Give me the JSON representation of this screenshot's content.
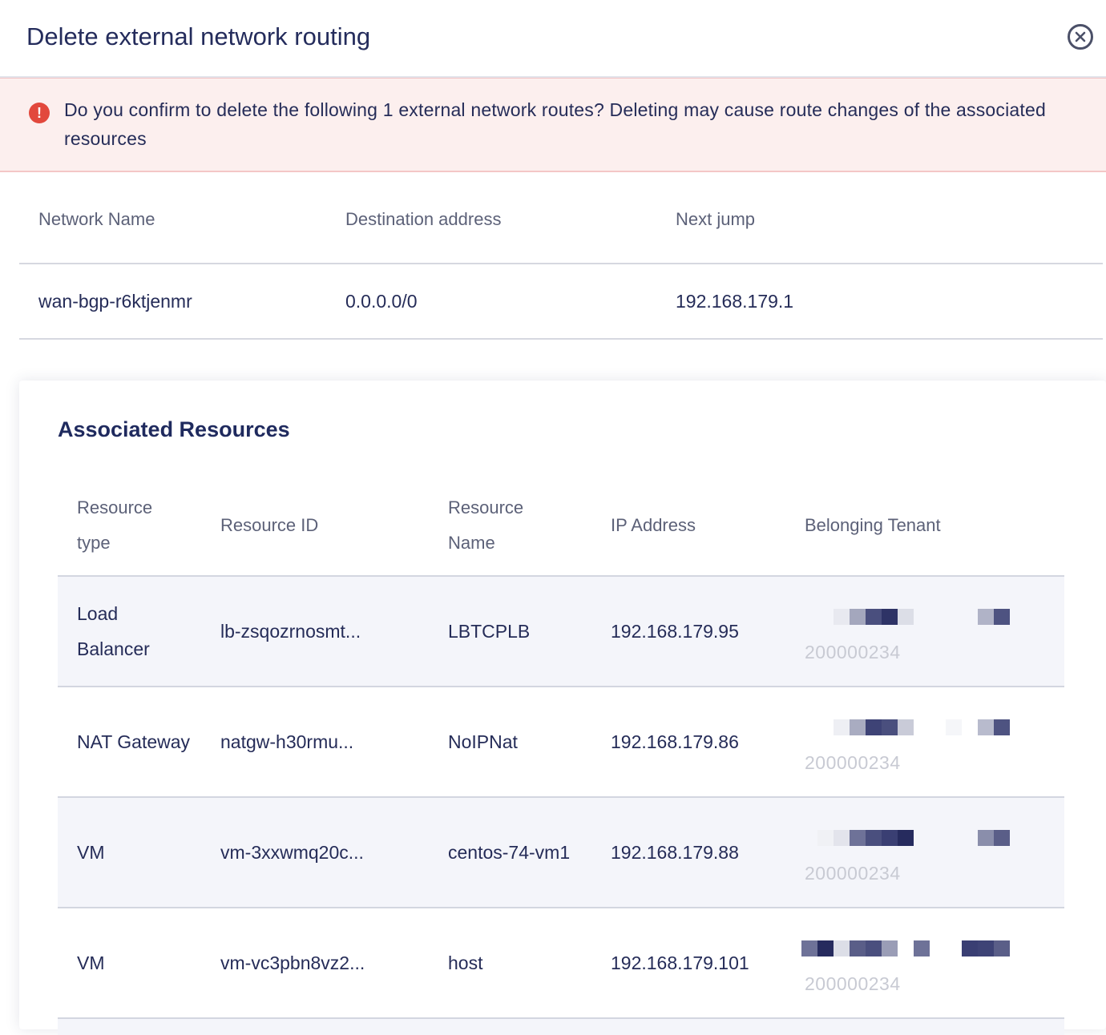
{
  "dialog": {
    "title": "Delete external network routing"
  },
  "alert": {
    "message": "Do you confirm to delete the following 1 external network routes? Deleting may cause route changes of the associated resources"
  },
  "routes": {
    "headers": [
      "Network Name",
      "Destination address",
      "Next jump"
    ],
    "rows": [
      [
        "wan-bgp-r6ktjenmr",
        "0.0.0.0/0",
        "192.168.179.1"
      ]
    ]
  },
  "associated": {
    "title": "Associated Resources",
    "headers": [
      "Resource type",
      "Resource ID",
      "Resource Name",
      "IP Address",
      "Belonging Tenant"
    ],
    "rows": [
      {
        "type": "Load Balancer",
        "id": "lb-zsqozrnosmt...",
        "name": "LBTCPLB",
        "ip": "192.168.179.95",
        "tenant": "200000234"
      },
      {
        "type": "NAT Gateway",
        "id": "natgw-h30rmu...",
        "name": "NoIPNat",
        "ip": "192.168.179.86",
        "tenant": "200000234"
      },
      {
        "type": "VM",
        "id": "vm-3xxwmq20c...",
        "name": "centos-74-vm1",
        "ip": "192.168.179.88",
        "tenant": "200000234"
      },
      {
        "type": "VM",
        "id": "vm-vc3pbn8vz2...",
        "name": "host",
        "ip": "192.168.179.101",
        "tenant": "200000234"
      }
    ]
  },
  "colors": {
    "accent": "#242c5c",
    "alert_bg": "#fcefee",
    "alert_icon": "#e2483c",
    "row_shade": "#f4f5fa"
  },
  "icons": {
    "close": "close-circle-icon",
    "alert": "exclamation-circle-icon"
  }
}
